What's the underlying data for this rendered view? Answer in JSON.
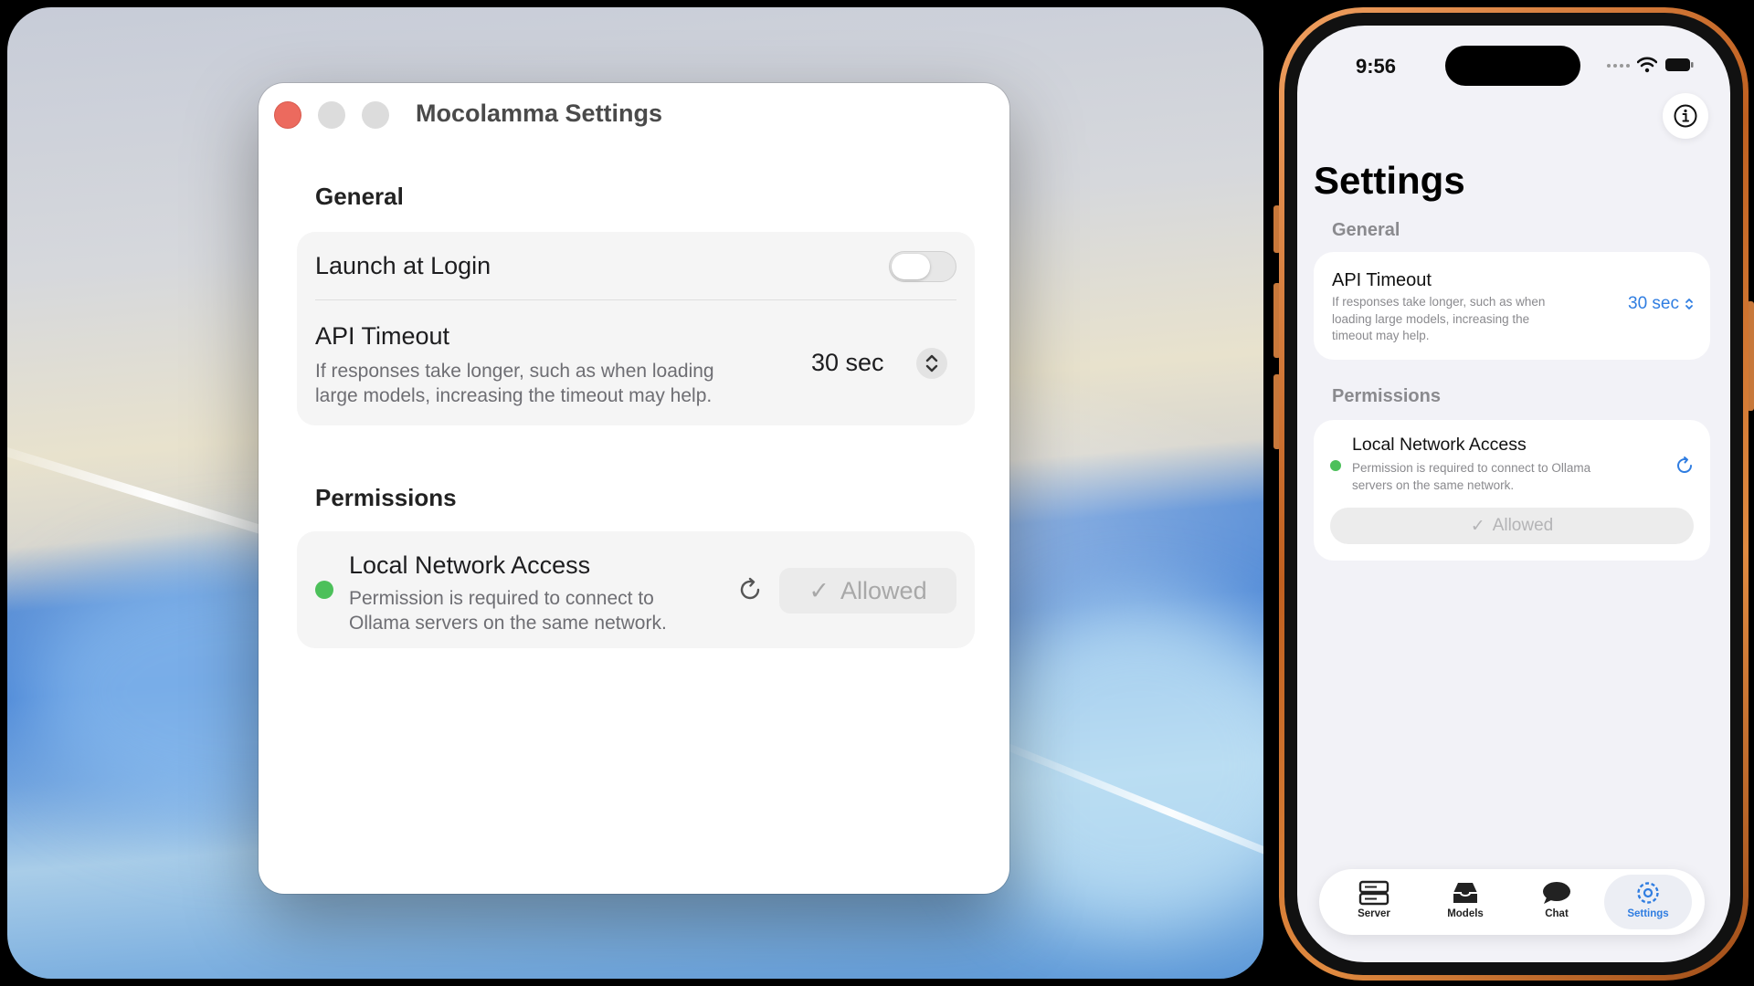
{
  "mac": {
    "window_title": "Mocolamma Settings",
    "general": {
      "title": "General",
      "launch_at_login": {
        "label": "Launch at Login",
        "enabled": false
      },
      "api_timeout": {
        "label": "API Timeout",
        "description_line1": "If responses take longer, such as when loading",
        "description_line2": "large models, increasing the timeout may help.",
        "value": "30 sec"
      }
    },
    "permissions": {
      "title": "Permissions",
      "local_network": {
        "label": "Local Network Access",
        "description_line1": "Permission is required to connect to",
        "description_line2": "Ollama servers on the same network.",
        "status_color": "#4cc05a",
        "button": "Allowed",
        "button_icon": "✓"
      }
    }
  },
  "ios": {
    "status_time": "9:56",
    "large_title": "Settings",
    "general": {
      "title": "General",
      "api_timeout": {
        "label": "API Timeout",
        "description_line1": "If responses take longer, such as when",
        "description_line2": "loading large models, increasing the",
        "description_line3": "timeout may help.",
        "value": "30 sec"
      }
    },
    "permissions": {
      "title": "Permissions",
      "local_network": {
        "label": "Local Network Access",
        "description_line1": "Permission is required to connect to Ollama",
        "description_line2": "servers on the same network.",
        "status_color": "#4cc05a",
        "button": "Allowed",
        "button_icon": "✓"
      }
    },
    "tabs": [
      {
        "label": "Server",
        "icon": "server-icon",
        "active": false
      },
      {
        "label": "Models",
        "icon": "tray-icon",
        "active": false
      },
      {
        "label": "Chat",
        "icon": "chat-bubble-icon",
        "active": false
      },
      {
        "label": "Settings",
        "icon": "gear-icon",
        "active": true
      }
    ],
    "accent_color": "#2f7de1"
  }
}
